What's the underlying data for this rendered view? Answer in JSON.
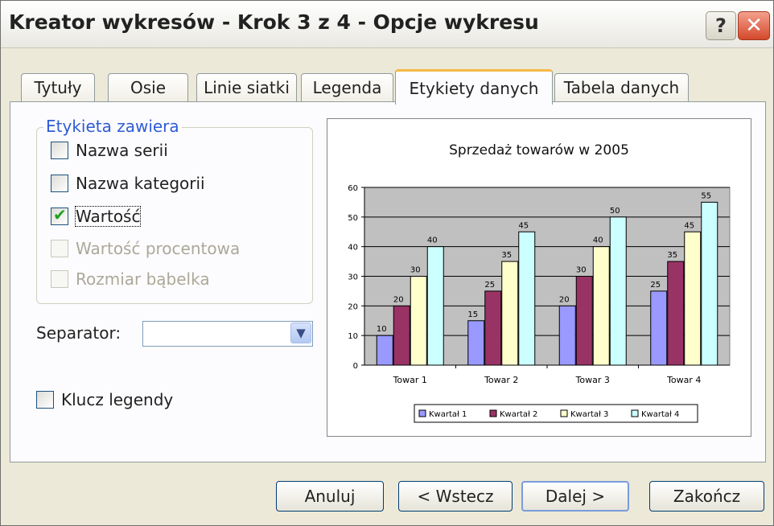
{
  "window": {
    "title": "Kreator wykresów - Krok 3 z 4 - Opcje wykresu",
    "help_glyph": "?",
    "close_glyph": "✕"
  },
  "tabs": [
    {
      "label": "Tytuły",
      "active": false
    },
    {
      "label": "Osie",
      "active": false
    },
    {
      "label": "Linie siatki",
      "active": false
    },
    {
      "label": "Legenda",
      "active": false
    },
    {
      "label": "Etykiety danych",
      "active": true
    },
    {
      "label": "Tabela danych",
      "active": false
    }
  ],
  "label_group": {
    "legend": "Etykieta zawiera",
    "options": [
      {
        "label": "Nazwa serii",
        "checked": false,
        "enabled": true
      },
      {
        "label": "Nazwa kategorii",
        "checked": false,
        "enabled": true
      },
      {
        "label": "Wartość",
        "checked": true,
        "enabled": true
      },
      {
        "label": "Wartość procentowa",
        "checked": false,
        "enabled": false
      },
      {
        "label": "Rozmiar bąbelka",
        "checked": false,
        "enabled": false
      }
    ]
  },
  "separator": {
    "label": "Separator:",
    "value": ""
  },
  "legend_key": {
    "label": "Klucz legendy",
    "checked": false
  },
  "buttons": {
    "cancel": "Anuluj",
    "back": "< Wstecz",
    "next": "Dalej >",
    "finish": "Zakończ"
  },
  "colors": {
    "accent_tab": "#f5b945",
    "series": [
      "#9999ff",
      "#993366",
      "#ffffcc",
      "#ccffff"
    ],
    "plot_bg": "#c0c0c0"
  },
  "chart_data": {
    "type": "bar",
    "title": "Sprzedaż towarów w 2005",
    "categories": [
      "Towar 1",
      "Towar 2",
      "Towar 3",
      "Towar 4"
    ],
    "series": [
      {
        "name": "Kwartał 1",
        "values": [
          10,
          15,
          20,
          25
        ]
      },
      {
        "name": "Kwartał 2",
        "values": [
          20,
          25,
          30,
          35
        ]
      },
      {
        "name": "Kwartał 3",
        "values": [
          30,
          35,
          40,
          45
        ]
      },
      {
        "name": "Kwartał 4",
        "values": [
          40,
          45,
          50,
          55
        ]
      }
    ],
    "ylim": [
      0,
      60
    ],
    "yticks": [
      0,
      10,
      20,
      30,
      40,
      50,
      60
    ],
    "grid": true,
    "legend_position": "bottom",
    "data_labels": true
  }
}
